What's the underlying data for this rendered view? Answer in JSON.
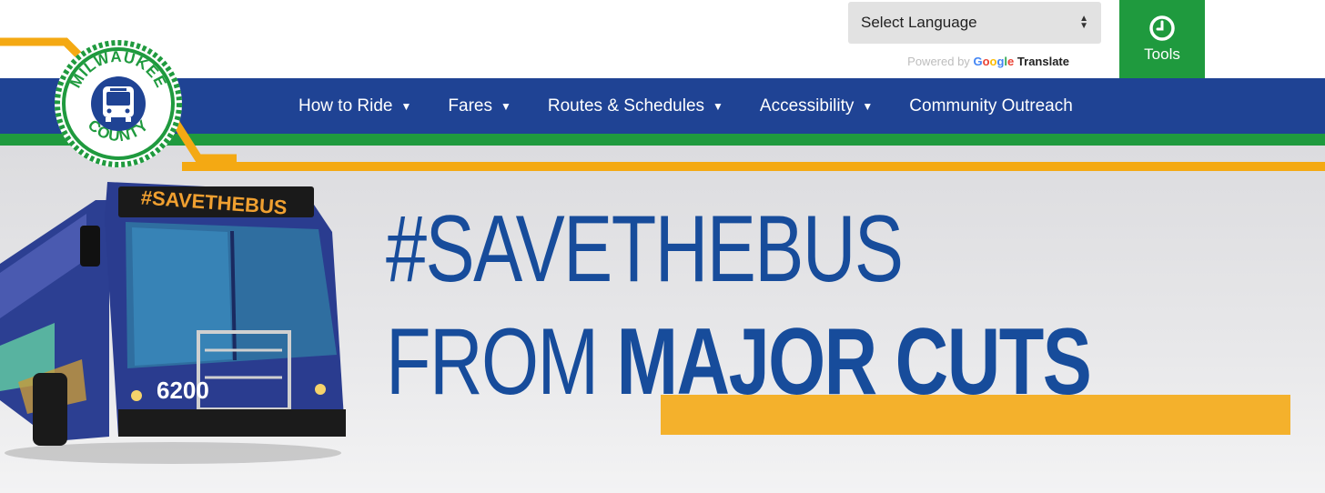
{
  "header": {
    "language_select_label": "Select Language",
    "powered_by_prefix": "Powered by",
    "google_letters": [
      "G",
      "o",
      "o",
      "g",
      "l",
      "e"
    ],
    "translate_label": "Translate",
    "tools_label": "Tools"
  },
  "logo": {
    "top_text": "MILWAUKEE",
    "bottom_text": "COUNTY"
  },
  "nav": {
    "items": [
      {
        "label": "How to Ride",
        "has_dropdown": true
      },
      {
        "label": "Fares",
        "has_dropdown": true
      },
      {
        "label": "Routes & Schedules",
        "has_dropdown": true
      },
      {
        "label": "Accessibility",
        "has_dropdown": true
      },
      {
        "label": "Community Outreach",
        "has_dropdown": false
      }
    ],
    "dropdown_glyph": "▼"
  },
  "hero": {
    "line1": "#SAVETHEBUS",
    "line2_regular": "FROM ",
    "line2_bold": "MAJOR CUTS",
    "bus_sign": "#SAVETHEBUS",
    "bus_number": "6200"
  },
  "colors": {
    "nav_blue": "#1f4394",
    "accent_green": "#1f9a3e",
    "accent_orange": "#f4a913",
    "headline_blue": "#174c9b"
  }
}
